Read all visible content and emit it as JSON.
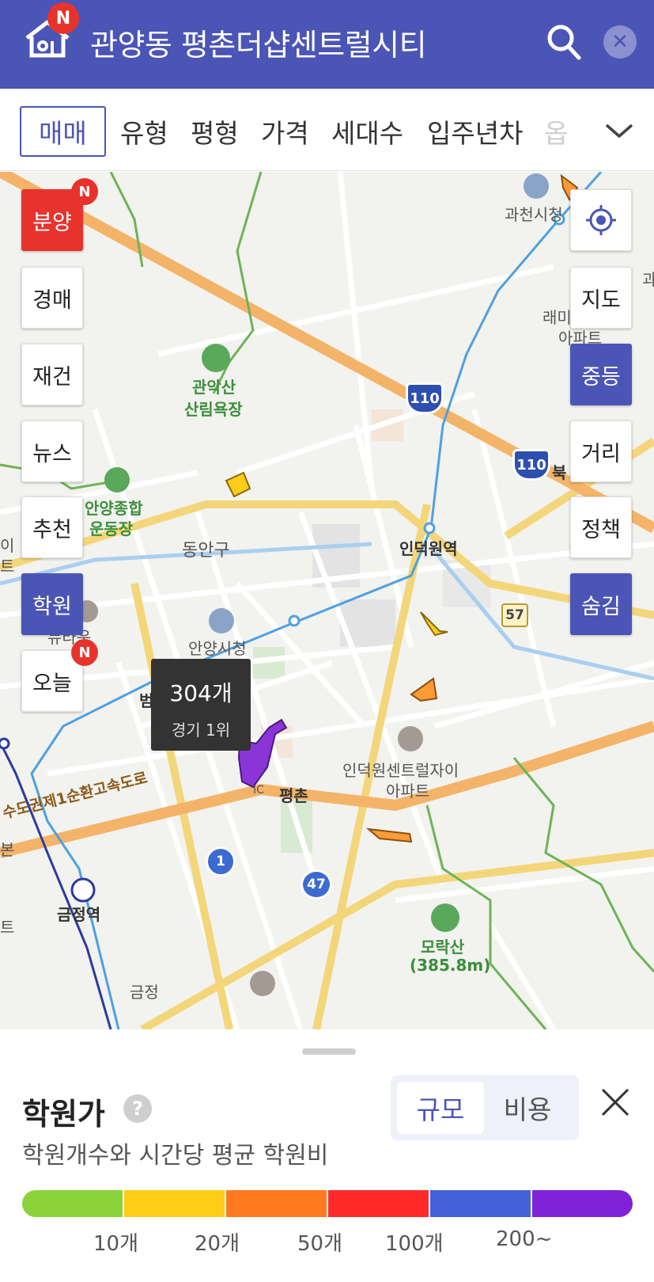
{
  "header": {
    "title": "관양동 평촌더샵센트럴시티",
    "badge": "N",
    "bg_color": "#4b55b5"
  },
  "filters": {
    "items": [
      "매매",
      "유형",
      "평형",
      "가격",
      "세대수",
      "입주년차",
      "옵"
    ],
    "active": "매매"
  },
  "left_buttons": {
    "items": [
      "분양",
      "경매",
      "재건",
      "뉴스",
      "추천",
      "학원",
      "오늘"
    ],
    "badge": "N"
  },
  "right_buttons": {
    "items": [
      "지도",
      "중등",
      "거리",
      "정책",
      "숨김"
    ]
  },
  "map_labels": {
    "gwacheon": "과천시청",
    "gwanak": "관악산",
    "gwanak2": "산림욕장",
    "sports": "안양종합",
    "sports2": "운동장",
    "dongan": "동안구",
    "indeogwon": "인덕원역",
    "anyang_hall": "안양시청",
    "beomgye": "범계",
    "pyeongchon": "평촌",
    "central_xi": "인덕원센트럴자이",
    "central_xi2": "아파트",
    "expressway": "수도권제1순환고속도로",
    "geumjeong": "금정역",
    "morak": "모락산",
    "morak_height": "(385.8m)",
    "raemi": "래미",
    "raemi2": "아파트",
    "buk": "북",
    "ic": "IC",
    "geumjeong_ic": "금정",
    "town": "뉴타운",
    "left_cut": "이",
    "left_cut2": "트",
    "left_cut3": "본",
    "left_cut4": "트",
    "right_cut": "과"
  },
  "road_signs": {
    "route110a": "110",
    "route110b": "110",
    "route57": "57",
    "route1": "1",
    "route47": "47"
  },
  "tooltip": {
    "count": "304개",
    "rank": "경기 1위"
  },
  "sheet": {
    "title": "학원가",
    "help": "?",
    "toggle_on": "규모",
    "toggle_off": "비용",
    "description": "학원개수와 시간당 평균 학원비",
    "legend_colors": [
      "#8bd23b",
      "#ffcc18",
      "#ff7a1f",
      "#ff2b2b",
      "#4361d8",
      "#7f22d9"
    ],
    "legend_labels": [
      "10개",
      "20개",
      "50개",
      "100개",
      "200~"
    ]
  }
}
